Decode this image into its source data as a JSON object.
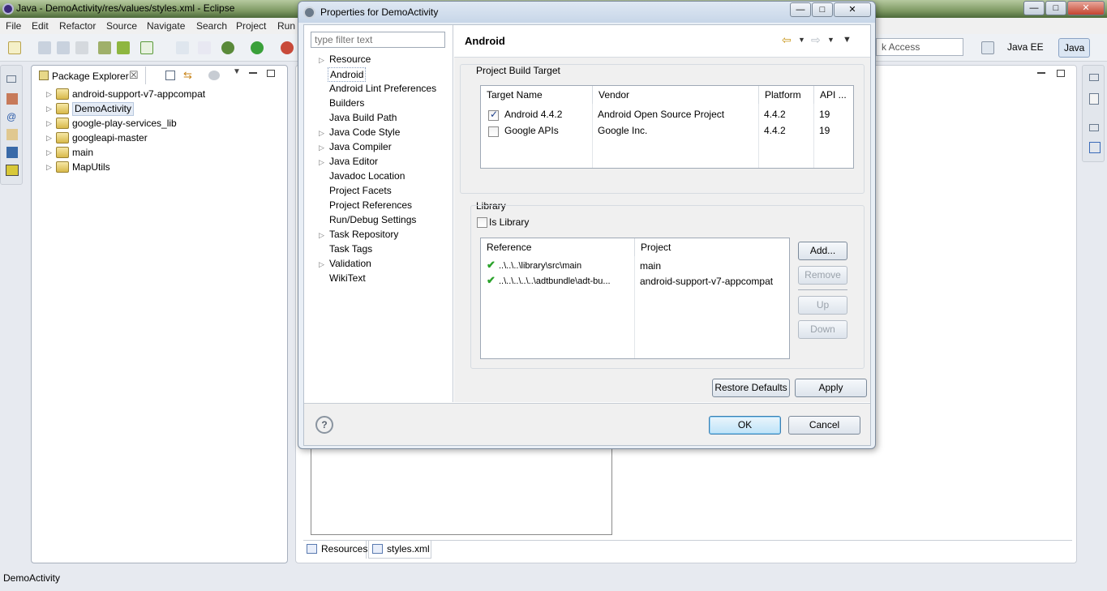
{
  "window": {
    "title": "Java - DemoActivity/res/values/styles.xml - Eclipse",
    "min": "—",
    "max": "□",
    "close": "✕"
  },
  "menu": [
    "File",
    "Edit",
    "Refactor",
    "Source",
    "Navigate",
    "Search",
    "Project",
    "Run"
  ],
  "toolbar": {
    "quick_access": "k Access",
    "perspectives": [
      "Java EE",
      "Java"
    ]
  },
  "package_explorer": {
    "title": "Package Explorer",
    "close": "☒",
    "projects": [
      "android-support-v7-appcompat",
      "DemoActivity",
      "google-play-services_lib",
      "googleapi-master",
      "main",
      "MapUtils"
    ]
  },
  "editor": {
    "tabs": [
      "Resources",
      "styles.xml"
    ]
  },
  "status": "DemoActivity",
  "dialog": {
    "title": "Properties for DemoActivity",
    "filter_placeholder": "type filter text",
    "nav": [
      {
        "label": "Resource",
        "expandable": true
      },
      {
        "label": "Android",
        "expandable": false
      },
      {
        "label": "Android Lint Preferences",
        "expandable": false
      },
      {
        "label": "Builders",
        "expandable": false
      },
      {
        "label": "Java Build Path",
        "expandable": false
      },
      {
        "label": "Java Code Style",
        "expandable": true
      },
      {
        "label": "Java Compiler",
        "expandable": true
      },
      {
        "label": "Java Editor",
        "expandable": true
      },
      {
        "label": "Javadoc Location",
        "expandable": false
      },
      {
        "label": "Project Facets",
        "expandable": false
      },
      {
        "label": "Project References",
        "expandable": false
      },
      {
        "label": "Run/Debug Settings",
        "expandable": false
      },
      {
        "label": "Task Repository",
        "expandable": true
      },
      {
        "label": "Task Tags",
        "expandable": false
      },
      {
        "label": "Validation",
        "expandable": true
      },
      {
        "label": "WikiText",
        "expandable": false
      }
    ],
    "page_title": "Android",
    "build_target": {
      "label": "Project Build Target",
      "columns": [
        "Target Name",
        "Vendor",
        "Platform",
        "API ..."
      ],
      "rows": [
        {
          "checked": true,
          "name": "Android 4.4.2",
          "vendor": "Android Open Source Project",
          "platform": "4.4.2",
          "api": "19"
        },
        {
          "checked": false,
          "name": "Google APIs",
          "vendor": "Google Inc.",
          "platform": "4.4.2",
          "api": "19"
        }
      ]
    },
    "library": {
      "label": "Library",
      "is_library": "Is Library",
      "columns": [
        "Reference",
        "Project"
      ],
      "rows": [
        {
          "reference": "..\\..\\..\\library\\src\\main",
          "project": "main"
        },
        {
          "reference": "..\\..\\..\\..\\..\\adtbundle\\adt-bu...",
          "project": "android-support-v7-appcompat"
        }
      ],
      "buttons": {
        "add": "Add...",
        "remove": "Remove",
        "up": "Up",
        "down": "Down"
      }
    },
    "restore_defaults": "Restore Defaults",
    "apply": "Apply",
    "ok": "OK",
    "cancel": "Cancel",
    "help": "?"
  }
}
